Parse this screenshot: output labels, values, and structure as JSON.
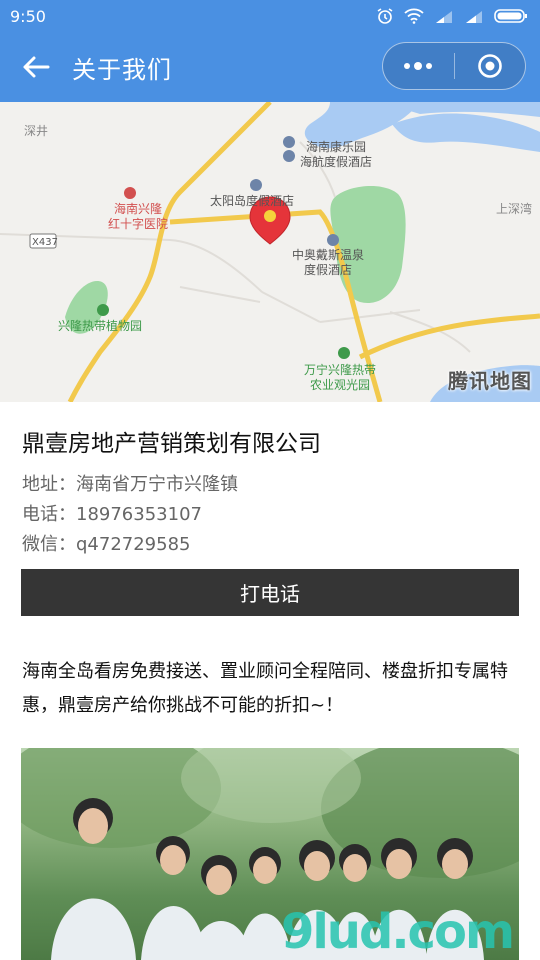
{
  "status_bar": {
    "time": "9:50"
  },
  "nav": {
    "title": "关于我们"
  },
  "map": {
    "labels": {
      "shenjing": "深井",
      "kangle_1": "海南康乐园",
      "kangle_2": "海航度假酒店",
      "hospital_1": "海南兴隆",
      "hospital_2": "红十字医院",
      "taiyangdao": "太阳岛度假酒店",
      "shangshenwan": "上深湾",
      "road": "X437",
      "zhongao_1": "中奥戴斯温泉",
      "zhongao_2": "度假酒店",
      "botanical": "兴隆热带植物园",
      "wanning_1": "万宁兴隆热带",
      "wanning_2": "农业观光园"
    },
    "watermark": "腾讯地图"
  },
  "company": {
    "name": "鼎壹房地产营销策划有限公司",
    "address": "地址：海南省万宁市兴隆镇",
    "phone": "电话：18976353107",
    "wechat": "微信：q472729585"
  },
  "call_button": "打电话",
  "description": "海南全岛看房免费接送、置业顾问全程陪同、楼盘折扣专属特惠，鼎壹房产给你挑战不可能的折扣~！",
  "photo": {
    "watermark": "9lud.com"
  }
}
